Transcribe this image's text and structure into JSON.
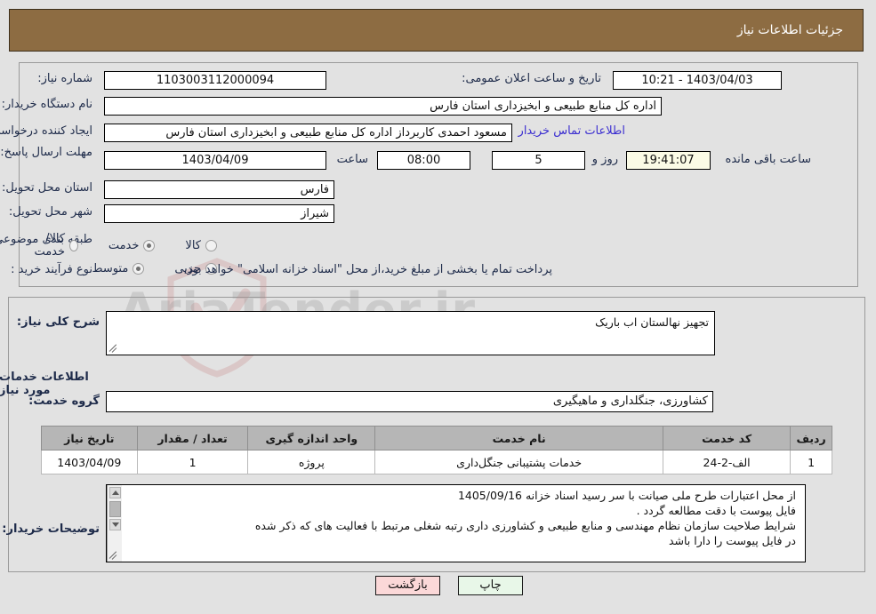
{
  "header": {
    "title": "جزئیات اطلاعات نیاز"
  },
  "top_form": {
    "need_number_label": "شماره نیاز:",
    "need_number_value": "1103003112000094",
    "public_announce_label": "تاریخ و ساعت اعلان عمومی:",
    "public_announce_value": "1403/04/03 - 10:21",
    "buyer_org_label": "نام دستگاه خریدار:",
    "buyer_org_value": "اداره کل منابع طبیعی و ابخیزداری استان فارس",
    "requester_label": "ایجاد کننده درخواست:",
    "requester_value": "مسعود احمدی کاربرداز اداره کل منابع طبیعی و ابخیزداری استان فارس",
    "contact_link": "اطلاعات تماس خریدار",
    "deadline_label": "مهلت ارسال پاسخ: تا تاریخ:",
    "deadline_date": "1403/04/09",
    "hour_label": "ساعت",
    "hour_value": "08:00",
    "days_value": "5",
    "days_label": "روز و",
    "countdown_value": "19:41:07",
    "countdown_label": "ساعت باقی مانده",
    "province_label": "استان محل تحویل:",
    "province_value": "فارس",
    "city_label": "شهر محل تحویل:",
    "city_value": "شیراز",
    "category_label": "طبقه بندی موضوعی:",
    "category_options": [
      {
        "label": "کالا",
        "selected": false
      },
      {
        "label": "خدمت",
        "selected": true
      },
      {
        "label": "کالا/خدمت",
        "selected": false
      }
    ],
    "process_label": "نوع فرآیند خرید :",
    "process_options": [
      {
        "label": "جزیی",
        "selected": false
      },
      {
        "label": "متوسط",
        "selected": true
      }
    ],
    "process_note": "پرداخت تمام یا بخشی از مبلغ خرید،از محل \"اسناد خزانه اسلامی\" خواهد بود."
  },
  "middle": {
    "general_desc_label": "شرح کلی نیاز:",
    "general_desc_value": "تجهیز نهالستان اب باریک",
    "services_info_heading": "اطلاعات خدمات مورد نیاز",
    "service_group_label": "گروه خدمت:",
    "service_group_value": "کشاورزی، جنگلداری و ماهیگیری"
  },
  "table": {
    "columns": [
      "ردیف",
      "کد خدمت",
      "نام خدمت",
      "واحد اندازه گیری",
      "تعداد / مقدار",
      "تاریخ نیاز"
    ],
    "rows": [
      {
        "row_no": "1",
        "service_code": "الف-2-24",
        "service_name": "خدمات پشتیبانی جنگل‌داری",
        "unit": "پروژه",
        "quantity": "1",
        "need_date": "1403/04/09"
      }
    ]
  },
  "comments": {
    "label": "توضیحات خریدار:",
    "lines": [
      "از محل اعتبارات طرح ملی صیانت با سر رسید اسناد خزانه 1405/09/16",
      "فایل پیوست با دقت مطالعه گردد .",
      "شرایط صلاحیت سازمان نظام مهندسی و منابع طبیعی و کشاورزی داری رتبه شغلی مرتبط با فعالیت های که ذکر شده",
      "در فایل پیوست را دارا باشد"
    ]
  },
  "footer": {
    "print_label": "چاپ",
    "back_label": "بازگشت"
  },
  "watermark": {
    "text": "AriaTender.ir"
  },
  "colors": {
    "header_bar": "#8d6c42",
    "page_bg": "#e2e2e2",
    "label_text": "#1e2b4a",
    "link": "#3b2ed0",
    "table_header": "#b6b6b6",
    "print_button": "#e8f7e8",
    "back_button": "#fbd8d8",
    "highlight_field": "#fbfbe6"
  }
}
